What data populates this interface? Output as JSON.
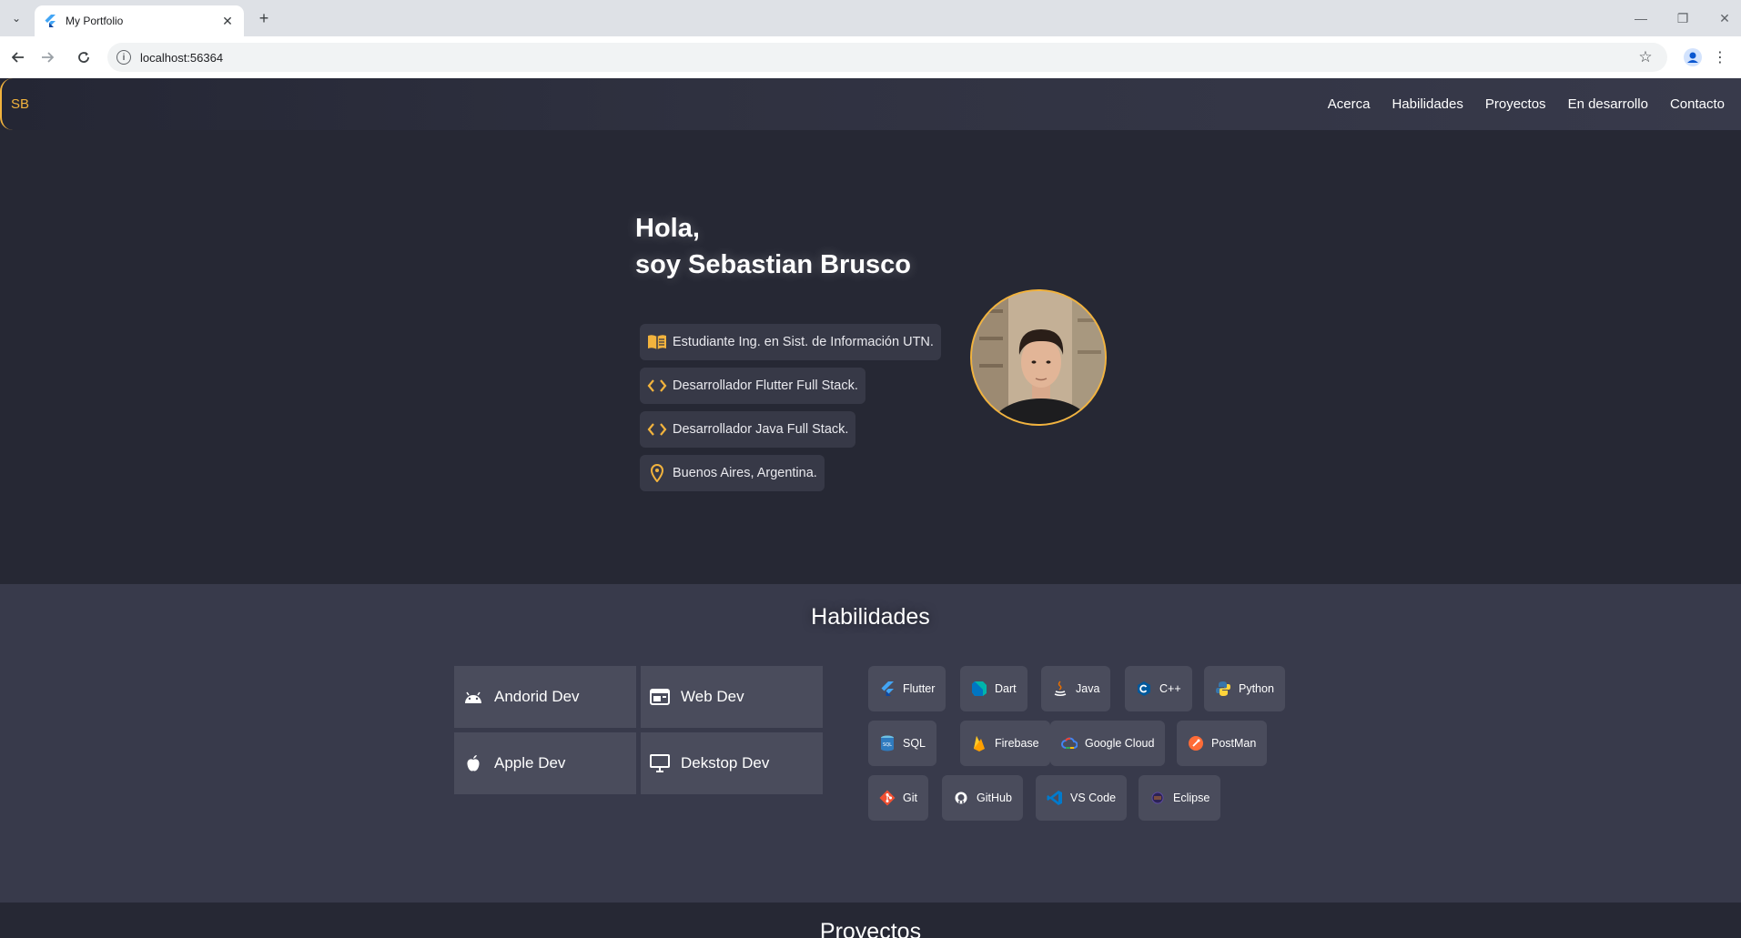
{
  "browser": {
    "tab_title": "My Portfolio",
    "tab_close": "✕",
    "new_tab": "+",
    "url": "localhost:56364",
    "window": {
      "minimize": "—",
      "restore": "❐",
      "close": "✕"
    }
  },
  "appbar": {
    "logo": "SB",
    "nav": [
      "Acerca",
      "Habilidades",
      "Proyectos",
      "En desarrollo",
      "Contacto"
    ]
  },
  "hero": {
    "greeting": "Hola,",
    "name_line": "soy Sebastian Brusco",
    "items": [
      {
        "icon": "book-icon",
        "text": "Estudiante Ing. en Sist. de Información UTN."
      },
      {
        "icon": "code-icon",
        "text": "Desarrollador Flutter Full Stack."
      },
      {
        "icon": "code-icon",
        "text": "Desarrollador Java Full Stack."
      },
      {
        "icon": "location-pin-icon",
        "text": "Buenos Aires, Argentina."
      }
    ]
  },
  "skills": {
    "title": "Habilidades",
    "dev_areas": [
      {
        "icon": "android-icon",
        "label": "Andorid Dev"
      },
      {
        "icon": "web-icon",
        "label": "Web Dev"
      },
      {
        "icon": "apple-icon",
        "label": "Apple Dev"
      },
      {
        "icon": "desktop-icon",
        "label": "Dekstop Dev"
      }
    ],
    "technologies": [
      {
        "label": "Flutter",
        "color": "#42a5f5"
      },
      {
        "label": "Dart",
        "color": "#00b4ab"
      },
      {
        "label": "Java",
        "color": "#e76f00"
      },
      {
        "label": "C++",
        "color": "#00599c"
      },
      {
        "label": "Python",
        "color": "#3776ab"
      },
      {
        "label": "SQL",
        "color": "#2f7bbf"
      },
      {
        "label": "Firebase",
        "color": "#ffca28"
      },
      {
        "label": "Google Cloud",
        "color": "#4285f4"
      },
      {
        "label": "PostMan",
        "color": "#ff6c37"
      },
      {
        "label": "Git",
        "color": "#f05032"
      },
      {
        "label": "GitHub",
        "color": "#ffffff"
      },
      {
        "label": "VS Code",
        "color": "#007acc"
      },
      {
        "label": "Eclipse",
        "color": "#2c2255"
      }
    ]
  },
  "projects": {
    "title": "Proyectos"
  },
  "colors": {
    "accent": "#f2b33d",
    "background": "#262834",
    "surface": "#383a4b",
    "card": "#4a4c5c"
  }
}
